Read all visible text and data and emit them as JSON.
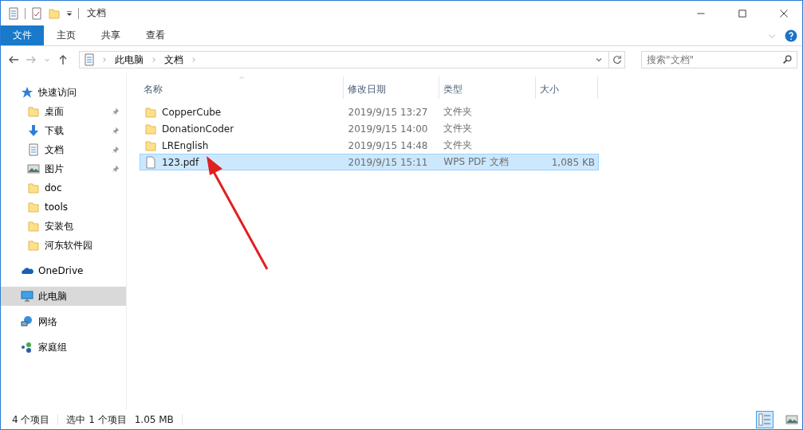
{
  "window": {
    "title": "文档"
  },
  "ribbon": {
    "tabs": [
      {
        "label": "文件",
        "kind": "file"
      },
      {
        "label": "主页",
        "kind": "tab"
      },
      {
        "label": "共享",
        "kind": "tab"
      },
      {
        "label": "查看",
        "kind": "tab"
      }
    ]
  },
  "address": {
    "path": [
      "此电脑",
      "文档"
    ]
  },
  "search": {
    "placeholder": "搜索\"文档\""
  },
  "sidebar": {
    "items": [
      {
        "label": "快速访问",
        "kind": "star",
        "pinned": false,
        "selected": false,
        "children": [
          {
            "label": "桌面",
            "kind": "folder",
            "pinned": true,
            "selected": false
          },
          {
            "label": "下载",
            "kind": "download",
            "pinned": true,
            "selected": false
          },
          {
            "label": "文档",
            "kind": "document",
            "pinned": true,
            "selected": false
          },
          {
            "label": "图片",
            "kind": "pictures",
            "pinned": true,
            "selected": false
          },
          {
            "label": "doc",
            "kind": "folder",
            "pinned": false,
            "selected": false
          },
          {
            "label": "tools",
            "kind": "folder",
            "pinned": false,
            "selected": false
          },
          {
            "label": "安装包",
            "kind": "folder",
            "pinned": false,
            "selected": false
          },
          {
            "label": "河东软件园",
            "kind": "folder",
            "pinned": false,
            "selected": false
          }
        ]
      },
      {
        "label": "OneDrive",
        "kind": "cloud",
        "pinned": false,
        "selected": false
      },
      {
        "label": "此电脑",
        "kind": "pc",
        "pinned": false,
        "selected": true
      },
      {
        "label": "网络",
        "kind": "network",
        "pinned": false,
        "selected": false
      },
      {
        "label": "家庭组",
        "kind": "homegroup",
        "pinned": false,
        "selected": false
      }
    ]
  },
  "table": {
    "columns": [
      {
        "label": "名称",
        "sorted": true
      },
      {
        "label": "修改日期",
        "sorted": false
      },
      {
        "label": "类型",
        "sorted": false
      },
      {
        "label": "大小",
        "sorted": false
      }
    ],
    "rows": [
      {
        "kind": "folder",
        "name": "CopperCube",
        "date": "2019/9/15 13:27",
        "type": "文件夹",
        "size": "",
        "selected": false
      },
      {
        "kind": "folder",
        "name": "DonationCoder",
        "date": "2019/9/15 14:00",
        "type": "文件夹",
        "size": "",
        "selected": false
      },
      {
        "kind": "folder",
        "name": "LREnglish",
        "date": "2019/9/15 14:48",
        "type": "文件夹",
        "size": "",
        "selected": false
      },
      {
        "kind": "file",
        "name": "123.pdf",
        "date": "2019/9/15 15:11",
        "type": "WPS PDF 文档",
        "size": "1,085 KB",
        "selected": true
      }
    ]
  },
  "status_bar": {
    "items": [
      "4 个项目",
      "选中 1 个项目",
      "1.05 MB"
    ]
  }
}
